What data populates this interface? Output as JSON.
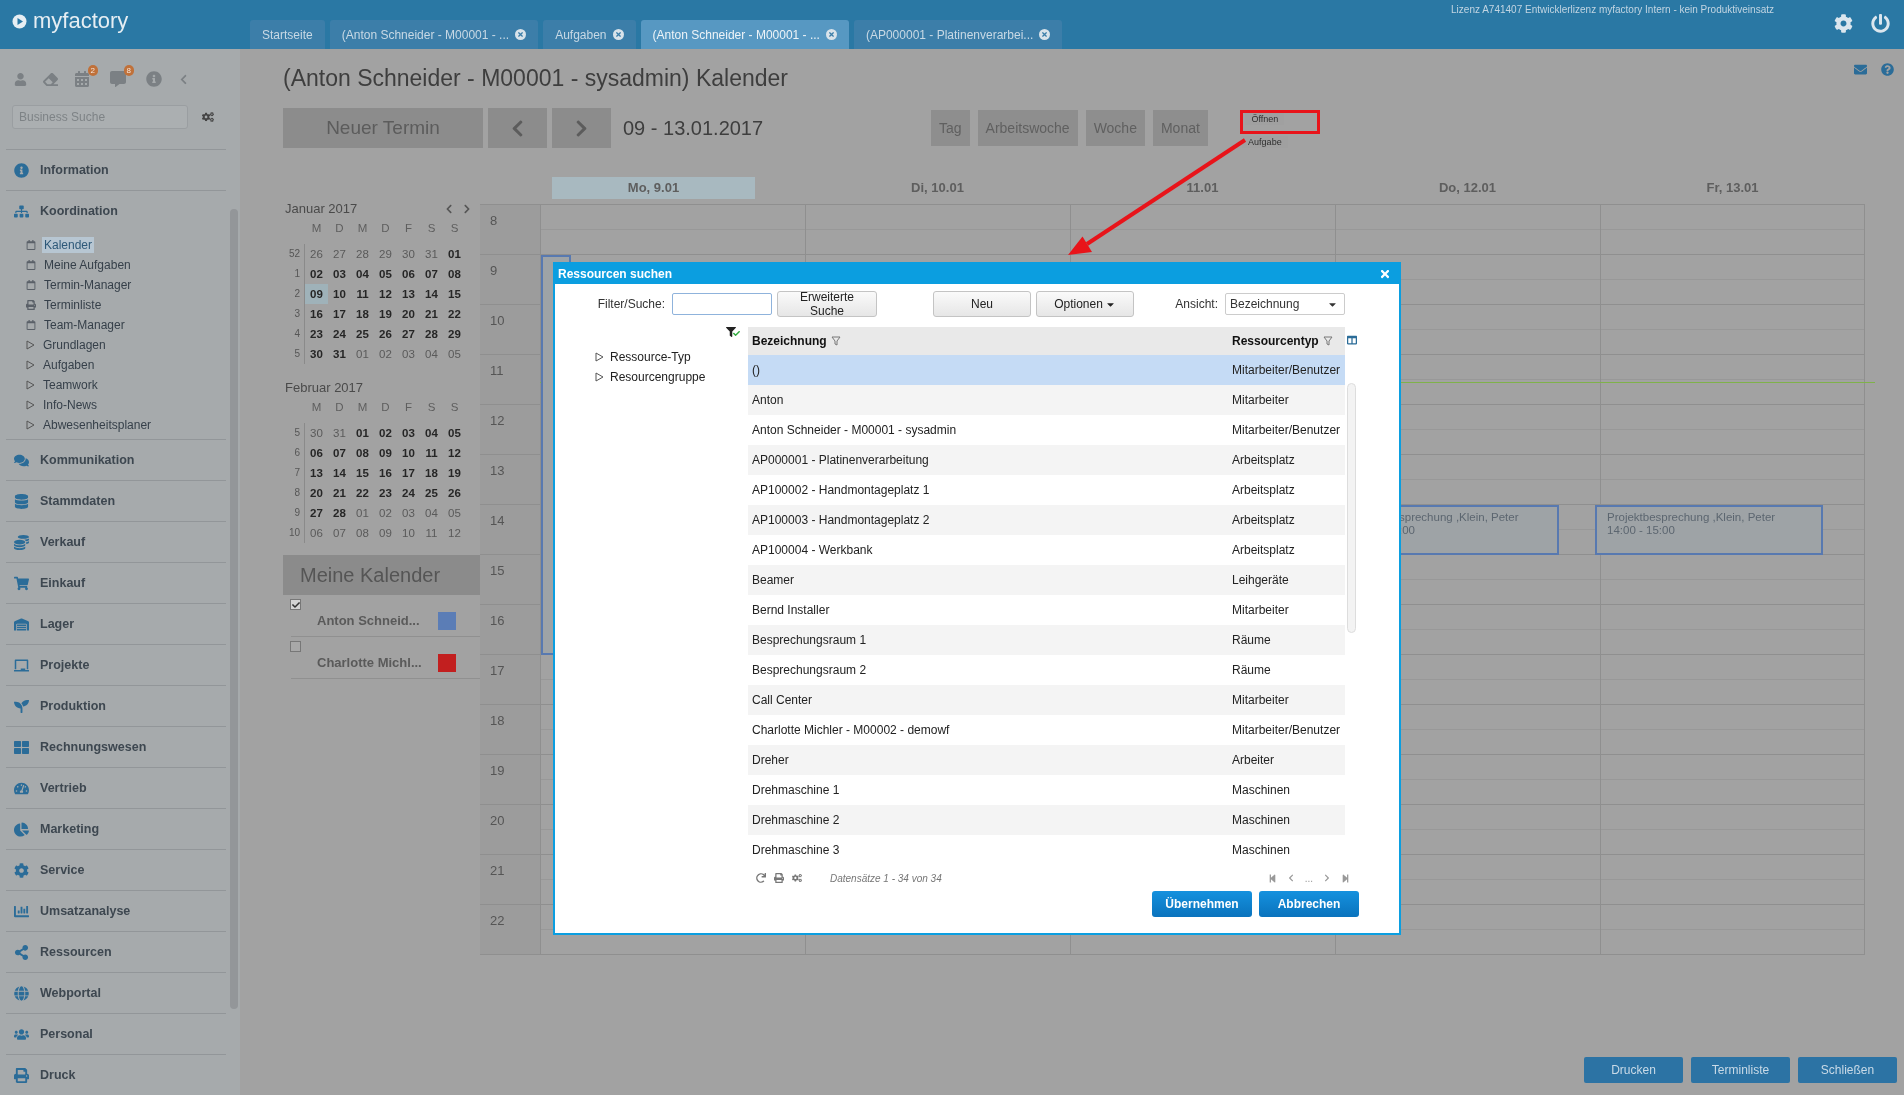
{
  "app": {
    "logo": "myfactory",
    "license": "Lizenz A741407 Entwicklerlizenz myfactory Intern - kein Produktiveinsatz"
  },
  "tabs": [
    {
      "label": "Startseite",
      "selected": false,
      "closable": false
    },
    {
      "label": "(Anton Schneider - M00001 - ...",
      "selected": false,
      "closable": true
    },
    {
      "label": "Aufgaben",
      "selected": false,
      "closable": true
    },
    {
      "label": "(Anton Schneider - M00001 - ...",
      "selected": true,
      "closable": true
    },
    {
      "label": "(AP000001 - Platinenverarbei...",
      "selected": false,
      "closable": true
    }
  ],
  "sidebar": {
    "badges": [
      "2",
      "8"
    ],
    "search": {
      "placeholder": "Business Suche"
    },
    "items": [
      {
        "label": "Information"
      },
      {
        "label": "Koordination",
        "children": [
          {
            "label": "Kalender",
            "kind": "page",
            "selected": true
          },
          {
            "label": "Meine Aufgaben",
            "kind": "page",
            "selected": false
          },
          {
            "label": "Termin-Manager",
            "kind": "page",
            "selected": false
          },
          {
            "label": "Terminliste",
            "kind": "print",
            "selected": false
          },
          {
            "label": "Team-Manager",
            "kind": "page",
            "selected": false
          },
          {
            "label": "Grundlagen",
            "kind": "folder",
            "selected": false
          },
          {
            "label": "Aufgaben",
            "kind": "folder",
            "selected": false
          },
          {
            "label": "Teamwork",
            "kind": "folder",
            "selected": false
          },
          {
            "label": "Info-News",
            "kind": "folder",
            "selected": false
          },
          {
            "label": "Abwesenheitsplaner",
            "kind": "folder",
            "selected": false
          }
        ]
      },
      {
        "label": "Kommunikation"
      },
      {
        "label": "Stammdaten"
      },
      {
        "label": "Verkauf"
      },
      {
        "label": "Einkauf"
      },
      {
        "label": "Lager"
      },
      {
        "label": "Projekte"
      },
      {
        "label": "Produktion"
      },
      {
        "label": "Rechnungswesen"
      },
      {
        "label": "Vertrieb"
      },
      {
        "label": "Marketing"
      },
      {
        "label": "Service"
      },
      {
        "label": "Umsatzanalyse"
      },
      {
        "label": "Ressourcen"
      },
      {
        "label": "Webportal"
      },
      {
        "label": "Personal"
      },
      {
        "label": "Druck"
      }
    ]
  },
  "page": {
    "title": "(Anton Schneider - M00001 - sysadmin) Kalender",
    "new_button": "Neuer Termin",
    "date_range": "09 - 13.01.2017",
    "views": [
      "Tag",
      "Arbeitswoche",
      "Woche",
      "Monat"
    ],
    "open_buttons": [
      "Öffnen",
      "Aufgabe"
    ]
  },
  "mini_calendars": [
    {
      "title": "Januar 2017",
      "weekdays": [
        "M",
        "D",
        "M",
        "D",
        "F",
        "S",
        "S"
      ],
      "weeks": [
        {
          "number": "52",
          "days": [
            {
              "label": "26",
              "muted": true,
              "selected": false
            },
            {
              "label": "27",
              "muted": true,
              "selected": false
            },
            {
              "label": "28",
              "muted": true,
              "selected": false
            },
            {
              "label": "29",
              "muted": true,
              "selected": false
            },
            {
              "label": "30",
              "muted": true,
              "selected": false
            },
            {
              "label": "31",
              "muted": true,
              "selected": false
            },
            {
              "label": "01",
              "muted": false,
              "selected": false
            }
          ]
        },
        {
          "number": "1",
          "days": [
            {
              "label": "02",
              "muted": false,
              "selected": false
            },
            {
              "label": "03",
              "muted": false,
              "selected": false
            },
            {
              "label": "04",
              "muted": false,
              "selected": false
            },
            {
              "label": "05",
              "muted": false,
              "selected": false
            },
            {
              "label": "06",
              "muted": false,
              "selected": false
            },
            {
              "label": "07",
              "muted": false,
              "selected": false
            },
            {
              "label": "08",
              "muted": false,
              "selected": false
            }
          ]
        },
        {
          "number": "2",
          "days": [
            {
              "label": "09",
              "muted": false,
              "selected": true
            },
            {
              "label": "10",
              "muted": false,
              "selected": false
            },
            {
              "label": "11",
              "muted": false,
              "selected": false
            },
            {
              "label": "12",
              "muted": false,
              "selected": false
            },
            {
              "label": "13",
              "muted": false,
              "selected": false
            },
            {
              "label": "14",
              "muted": false,
              "selected": false
            },
            {
              "label": "15",
              "muted": false,
              "selected": false
            }
          ]
        },
        {
          "number": "3",
          "days": [
            {
              "label": "16",
              "muted": false,
              "selected": false
            },
            {
              "label": "17",
              "muted": false,
              "selected": false
            },
            {
              "label": "18",
              "muted": false,
              "selected": false
            },
            {
              "label": "19",
              "muted": false,
              "selected": false
            },
            {
              "label": "20",
              "muted": false,
              "selected": false
            },
            {
              "label": "21",
              "muted": false,
              "selected": false
            },
            {
              "label": "22",
              "muted": false,
              "selected": false
            }
          ]
        },
        {
          "number": "4",
          "days": [
            {
              "label": "23",
              "muted": false,
              "selected": false
            },
            {
              "label": "24",
              "muted": false,
              "selected": false
            },
            {
              "label": "25",
              "muted": false,
              "selected": false
            },
            {
              "label": "26",
              "muted": false,
              "selected": false
            },
            {
              "label": "27",
              "muted": false,
              "selected": false
            },
            {
              "label": "28",
              "muted": false,
              "selected": false
            },
            {
              "label": "29",
              "muted": false,
              "selected": false
            }
          ]
        },
        {
          "number": "5",
          "days": [
            {
              "label": "30",
              "muted": false,
              "selected": false
            },
            {
              "label": "31",
              "muted": false,
              "selected": false
            },
            {
              "label": "01",
              "muted": true,
              "selected": false
            },
            {
              "label": "02",
              "muted": true,
              "selected": false
            },
            {
              "label": "03",
              "muted": true,
              "selected": false
            },
            {
              "label": "04",
              "muted": true,
              "selected": false
            },
            {
              "label": "05",
              "muted": true,
              "selected": false
            }
          ]
        }
      ]
    },
    {
      "title": "Februar 2017",
      "weekdays": [
        "M",
        "D",
        "M",
        "D",
        "F",
        "S",
        "S"
      ],
      "weeks": [
        {
          "number": "5",
          "days": [
            {
              "label": "30",
              "muted": true,
              "selected": false
            },
            {
              "label": "31",
              "muted": true,
              "selected": false
            },
            {
              "label": "01",
              "muted": false,
              "selected": false
            },
            {
              "label": "02",
              "muted": false,
              "selected": false
            },
            {
              "label": "03",
              "muted": false,
              "selected": false
            },
            {
              "label": "04",
              "muted": false,
              "selected": false
            },
            {
              "label": "05",
              "muted": false,
              "selected": false
            }
          ]
        },
        {
          "number": "6",
          "days": [
            {
              "label": "06",
              "muted": false,
              "selected": false
            },
            {
              "label": "07",
              "muted": false,
              "selected": false
            },
            {
              "label": "08",
              "muted": false,
              "selected": false
            },
            {
              "label": "09",
              "muted": false,
              "selected": false
            },
            {
              "label": "10",
              "muted": false,
              "selected": false
            },
            {
              "label": "11",
              "muted": false,
              "selected": false
            },
            {
              "label": "12",
              "muted": false,
              "selected": false
            }
          ]
        },
        {
          "number": "7",
          "days": [
            {
              "label": "13",
              "muted": false,
              "selected": false
            },
            {
              "label": "14",
              "muted": false,
              "selected": false
            },
            {
              "label": "15",
              "muted": false,
              "selected": false
            },
            {
              "label": "16",
              "muted": false,
              "selected": false
            },
            {
              "label": "17",
              "muted": false,
              "selected": false
            },
            {
              "label": "18",
              "muted": false,
              "selected": false
            },
            {
              "label": "19",
              "muted": false,
              "selected": false
            }
          ]
        },
        {
          "number": "8",
          "days": [
            {
              "label": "20",
              "muted": false,
              "selected": false
            },
            {
              "label": "21",
              "muted": false,
              "selected": false
            },
            {
              "label": "22",
              "muted": false,
              "selected": false
            },
            {
              "label": "23",
              "muted": false,
              "selected": false
            },
            {
              "label": "24",
              "muted": false,
              "selected": false
            },
            {
              "label": "25",
              "muted": false,
              "selected": false
            },
            {
              "label": "26",
              "muted": false,
              "selected": false
            }
          ]
        },
        {
          "number": "9",
          "days": [
            {
              "label": "27",
              "muted": false,
              "selected": false
            },
            {
              "label": "28",
              "muted": false,
              "selected": false
            },
            {
              "label": "01",
              "muted": true,
              "selected": false
            },
            {
              "label": "02",
              "muted": true,
              "selected": false
            },
            {
              "label": "03",
              "muted": true,
              "selected": false
            },
            {
              "label": "04",
              "muted": true,
              "selected": false
            },
            {
              "label": "05",
              "muted": true,
              "selected": false
            }
          ]
        },
        {
          "number": "10",
          "days": [
            {
              "label": "06",
              "muted": true,
              "selected": false
            },
            {
              "label": "07",
              "muted": true,
              "selected": false
            },
            {
              "label": "08",
              "muted": true,
              "selected": false
            },
            {
              "label": "09",
              "muted": true,
              "selected": false
            },
            {
              "label": "10",
              "muted": true,
              "selected": false
            },
            {
              "label": "11",
              "muted": true,
              "selected": false
            },
            {
              "label": "12",
              "muted": true,
              "selected": false
            }
          ]
        }
      ]
    }
  ],
  "my_calendars": {
    "title": "Meine Kalender",
    "items": [
      {
        "name": "Anton Schneid...",
        "checked": true,
        "color": "#5b7db6"
      },
      {
        "name": "Charlotte Michl...",
        "checked": false,
        "color": "#c21f1f"
      }
    ]
  },
  "calendar": {
    "days": [
      {
        "label": "Mo, 9.01",
        "selected": true
      },
      {
        "label": "Di, 10.01",
        "selected": false
      },
      {
        "label": "11.01",
        "selected": false
      },
      {
        "label": "Do, 12.01",
        "selected": false
      },
      {
        "label": "Fr, 13.01",
        "selected": false
      }
    ],
    "hours": [
      "8",
      "9",
      "10",
      "11",
      "12",
      "13",
      "14",
      "15",
      "16",
      "17",
      "18",
      "19",
      "20",
      "21",
      "22"
    ],
    "events": [
      {
        "kind": "block"
      },
      {
        "kind": "entry",
        "title": "sprechung ,Klein, Peter",
        "time": ":00"
      },
      {
        "kind": "entry",
        "title": "Projektbesprechung ,Klein, Peter",
        "time": "14:00 - 15:00"
      }
    ]
  },
  "dialog": {
    "title": "Ressourcen suchen",
    "filter_label": "Filter/Suche:",
    "buttons": [
      "Erweiterte Suche",
      "Neu",
      "Optionen"
    ],
    "view_label": "Ansicht:",
    "view_value": "Bezeichnung",
    "tree": [
      "Ressource-Typ",
      "Resourcengruppe"
    ],
    "columns": [
      "Bezeichnung",
      "Ressourcentyp"
    ],
    "rows": [
      {
        "name": "()",
        "type": "Mitarbeiter/Benutzer",
        "selected": true
      },
      {
        "name": "Anton",
        "type": "Mitarbeiter",
        "selected": false
      },
      {
        "name": "Anton Schneider - M00001 - sysadmin",
        "type": "Mitarbeiter/Benutzer",
        "selected": false
      },
      {
        "name": "AP000001 - Platinenverarbeitung",
        "type": "Arbeitsplatz",
        "selected": false
      },
      {
        "name": "AP100002 - Handmontageplatz 1",
        "type": "Arbeitsplatz",
        "selected": false
      },
      {
        "name": "AP100003 - Handmontageplatz 2",
        "type": "Arbeitsplatz",
        "selected": false
      },
      {
        "name": "AP100004 - Werkbank",
        "type": "Arbeitsplatz",
        "selected": false
      },
      {
        "name": "Beamer",
        "type": "Leihgeräte",
        "selected": false
      },
      {
        "name": "Bernd Installer",
        "type": "Mitarbeiter",
        "selected": false
      },
      {
        "name": "Besprechungsraum 1",
        "type": "Räume",
        "selected": false
      },
      {
        "name": "Besprechungsraum 2",
        "type": "Räume",
        "selected": false
      },
      {
        "name": "Call Center",
        "type": "Mitarbeiter",
        "selected": false
      },
      {
        "name": "Charlotte Michler - M00002 - demowf",
        "type": "Mitarbeiter/Benutzer",
        "selected": false
      },
      {
        "name": "Dreher",
        "type": "Arbeiter",
        "selected": false
      },
      {
        "name": "Drehmaschine 1",
        "type": "Maschinen",
        "selected": false
      },
      {
        "name": "Drehmaschine 2",
        "type": "Maschinen",
        "selected": false
      },
      {
        "name": "Drehmaschine 3",
        "type": "Maschinen",
        "selected": false
      }
    ],
    "records": "Datensätze 1 - 34 von 34",
    "pager_gap": "...",
    "actions": [
      "Übernehmen",
      "Abbrechen"
    ]
  },
  "footer_buttons": [
    "Drucken",
    "Terminliste",
    "Schließen"
  ]
}
